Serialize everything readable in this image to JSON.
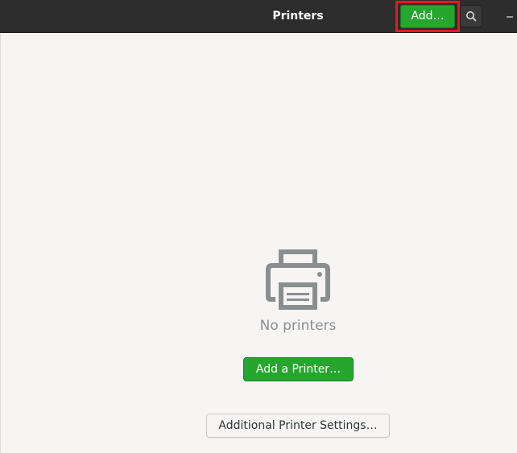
{
  "window": {
    "title": "Printers"
  },
  "headerbar": {
    "add_label": "Add…",
    "search_icon": "search-icon",
    "minimize_glyph": "–"
  },
  "empty_state": {
    "icon": "printer-icon",
    "message": "No printers",
    "add_printer_label": "Add a Printer…",
    "settings_label": "Additional Printer Settings…"
  },
  "colors": {
    "headerbar_bg": "#2d2d2d",
    "accent_green": "#26a62f",
    "highlight_red": "#e01b24",
    "content_bg": "#f6f5f4",
    "icon_gray": "#8b8e8f"
  }
}
